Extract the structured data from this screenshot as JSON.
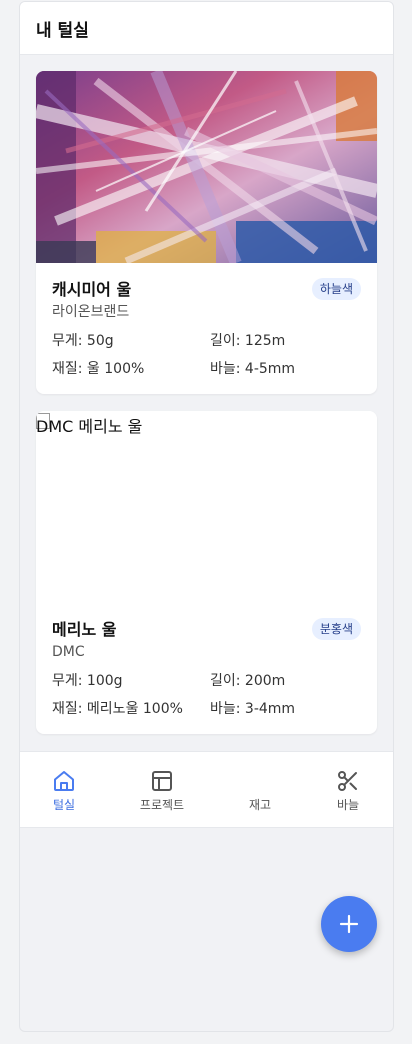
{
  "header": {
    "title": "내 털실"
  },
  "yarns": [
    {
      "name": "캐시미어 울",
      "brand": "라이온브랜드",
      "color": "하늘색",
      "weight": "무게: 50g",
      "length": "길이: 125m",
      "material": "재질: 울 100%",
      "needle": "바늘: 4-5mm",
      "image_alt": ""
    },
    {
      "name": "메리노 울",
      "brand": "DMC",
      "color": "분홍색",
      "weight": "무게: 100g",
      "length": "길이: 200m",
      "material": "재질: 메리노울 100%",
      "needle": "바늘: 3-4mm",
      "image_alt": "DMC 메리노 울"
    }
  ],
  "nav": {
    "items": [
      {
        "label": "털실",
        "icon": "home-icon",
        "active": true
      },
      {
        "label": "프로젝트",
        "icon": "layout-icon",
        "active": false
      },
      {
        "label": "재고",
        "icon": "",
        "active": false
      },
      {
        "label": "바늘",
        "icon": "scissors-icon",
        "active": false
      }
    ]
  },
  "colors": {
    "accent": "#4a7cf0",
    "badge_bg": "#e7efff",
    "badge_text": "#27408b"
  },
  "fab": {
    "icon": "plus-icon"
  }
}
